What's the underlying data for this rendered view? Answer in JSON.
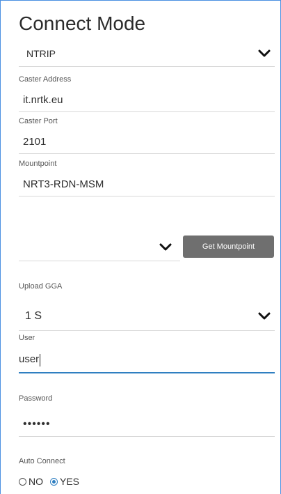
{
  "form": {
    "title": "Connect Mode",
    "connect_mode": {
      "value": "NTRIP"
    },
    "caster_address": {
      "label": "Caster Address",
      "value": "it.nrtk.eu"
    },
    "caster_port": {
      "label": "Caster Port",
      "value": "2101"
    },
    "mountpoint": {
      "label": "Mountpoint",
      "value": "NRT3-RDN-MSM"
    },
    "mountpoint_select": {
      "value": "",
      "button_label": "Get Mountpoint"
    },
    "upload_gga": {
      "label": "Upload GGA",
      "value": "1 S"
    },
    "user": {
      "label": "User",
      "value": "user"
    },
    "password": {
      "label": "Password",
      "value": "••••••"
    },
    "auto_connect": {
      "label": "Auto Connect",
      "options": [
        "NO",
        "YES"
      ],
      "selected": "YES"
    }
  },
  "colors": {
    "accent": "#2f7fc1",
    "button_bg": "#6f6f6f",
    "divider": "#d8d8d8",
    "frame_border": "#4a90e2"
  },
  "icons": {
    "dropdown": "chevron-down-icon",
    "radio": "radio-icon"
  }
}
